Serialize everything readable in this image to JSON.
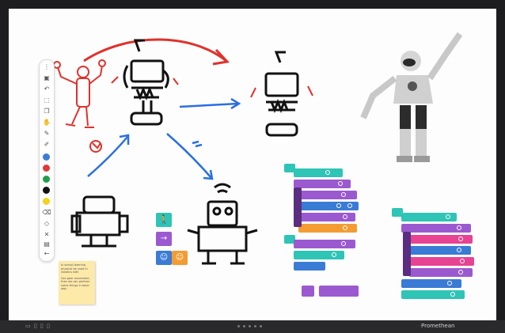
{
  "sticky_note": {
    "line1": "In school learning physical be used in robotics with",
    "line2": "Use gear movement, then we can perform some things in basic way"
  },
  "bottom_bar": {
    "left_label": "▭ ▯ ▯ ▯",
    "brand": "Promethean"
  },
  "toolbar": {
    "tools": [
      "more-icon",
      "save-icon",
      "undo-icon",
      "select-icon",
      "copy-icon",
      "hand-icon",
      "pen-icon",
      "highlighter-icon"
    ],
    "colors": [
      "#3d7bd6",
      "#e03b3b",
      "#1e9e4a",
      "#111111",
      "#f2d21a"
    ],
    "lower_tools": [
      "eraser-icon",
      "shape-icon",
      "clear-icon",
      "page-icon",
      "back-icon"
    ]
  }
}
